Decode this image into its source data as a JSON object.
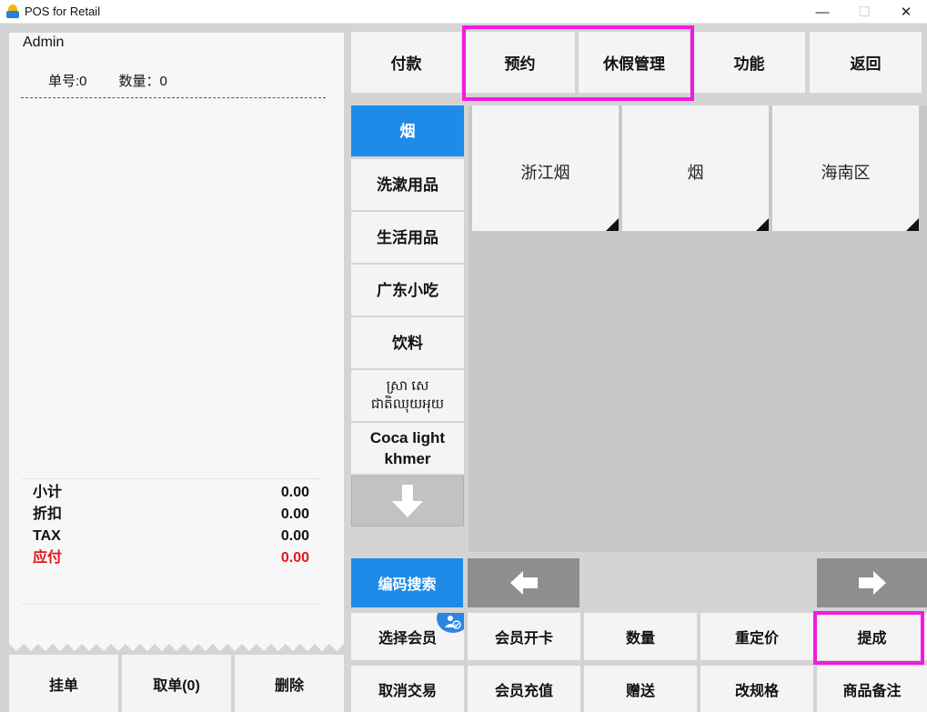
{
  "window": {
    "title": "POS for Retail",
    "minimize": "—",
    "maximize": "☐",
    "close": "✕"
  },
  "receipt": {
    "user": "Admin",
    "order_no_label": "单号:0",
    "qty_label": "数量：0",
    "totals": [
      {
        "label": "小计",
        "value": "0.00"
      },
      {
        "label": "折扣",
        "value": "0.00"
      },
      {
        "label": "TAX",
        "value": "0.00"
      },
      {
        "label": "应付",
        "value": "0.00"
      }
    ],
    "buttons": {
      "hold": "挂单",
      "retrieve": "取单(0)",
      "delete": "删除"
    }
  },
  "toolbar": {
    "pay": "付款",
    "reserve": "预约",
    "holiday": "休假管理",
    "functions": "功能",
    "back": "返回"
  },
  "categories": [
    {
      "label": "烟"
    },
    {
      "label": "洗漱用品"
    },
    {
      "label": "生活用品"
    },
    {
      "label": "广东小吃"
    },
    {
      "label": "饮料"
    },
    {
      "label": "ស្រា សេជាតិឈុយអុយ"
    },
    {
      "label": "Coca light khmer"
    }
  ],
  "products": [
    {
      "label": "浙江烟"
    },
    {
      "label": "烟"
    },
    {
      "label": "海南区"
    }
  ],
  "search": {
    "label": "编码搜索"
  },
  "functions": {
    "select_member": "选择会员",
    "member_card": "会员开卡",
    "quantity": "数量",
    "reprice": "重定价",
    "commission": "提成",
    "cancel_tx": "取消交易",
    "member_topup": "会员充值",
    "gift": "赠送",
    "change_spec": "改规格",
    "item_note": "商品备注"
  },
  "colors": {
    "accent": "#1e8be8",
    "highlight": "#f21ae0",
    "due": "#e8161b"
  }
}
